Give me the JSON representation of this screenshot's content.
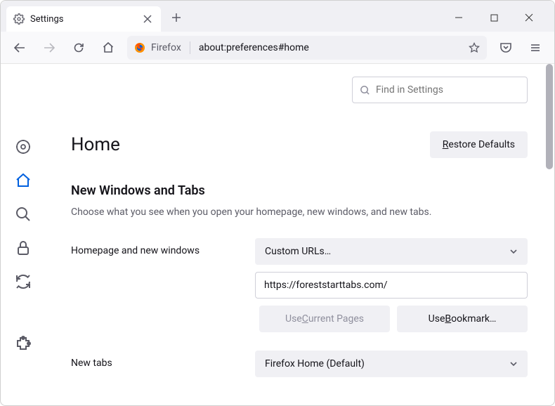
{
  "tab": {
    "title": "Settings"
  },
  "urlbar": {
    "identity": "Firefox",
    "url": "about:preferences#home"
  },
  "find": {
    "placeholder": "Find in Settings"
  },
  "page": {
    "title": "Home",
    "restore_label": "Restore Defaults",
    "section_title": "New Windows and Tabs",
    "section_desc": "Choose what you see when you open your homepage, new windows, and new tabs."
  },
  "homepage": {
    "label": "Homepage and new windows",
    "select_value": "Custom URLs…",
    "url_value": "https://foreststarttabs.com/",
    "use_current_label_pre": "Use ",
    "use_current_label_accel": "C",
    "use_current_label_post": "urrent Pages",
    "use_bookmark_label": "Use Bookmark…"
  },
  "newtabs": {
    "label": "New tabs",
    "select_value": "Firefox Home (Default)"
  },
  "restore_accel": "R",
  "restore_rest": "estore Defaults",
  "bookmark_accel": "B",
  "bookmark_pre": "Use ",
  "bookmark_rest": "ookmark…"
}
